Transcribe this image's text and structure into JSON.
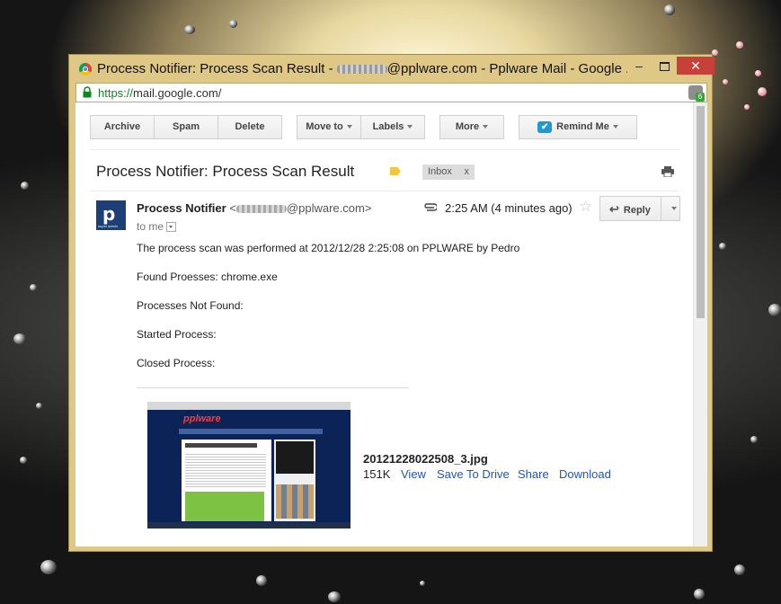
{
  "window": {
    "title_prefix": "Process Notifier: Process Scan Result - ",
    "title_suffix": "@pplware.com - Pplware Mail - Google ...",
    "minimize_label": "–",
    "close_label": "✕"
  },
  "address_bar": {
    "scheme": "https://",
    "host_path": "mail.google.com/",
    "extension_badge": "6"
  },
  "toolbar": {
    "archive": "Archive",
    "spam": "Spam",
    "delete": "Delete",
    "move_to": "Move to",
    "labels": "Labels",
    "more": "More",
    "remind_me": "Remind Me"
  },
  "email": {
    "subject": "Process Notifier: Process Scan Result",
    "label_chip": "Inbox",
    "label_chip_close": "x",
    "sender_name": "Process Notifier",
    "sender_email_prefix": " <",
    "sender_email_suffix": "@pplware.com>",
    "to_me": "to me",
    "time": "2:25 AM (4 minutes ago)",
    "reply_label": "Reply",
    "avatar_letter": "p",
    "avatar_caption": "super admin",
    "body": [
      "The process scan was performed at 2012/12/28 2:25:08 on PPLWARE by Pedro",
      "Found Proesses: chrome.exe",
      "Processes Not Found:",
      "Started Process:",
      "Closed Process:"
    ]
  },
  "attachment": {
    "filename": "20121228022508_3.jpg",
    "size": "151K",
    "actions": [
      "View",
      "Save To Drive",
      "Share",
      "Download"
    ],
    "thumb_logo": "pplware"
  },
  "colors": {
    "window_frame": "#dfc886",
    "close_button": "#c7413a",
    "link": "#1a55c8",
    "https": "#0a8a1a"
  }
}
